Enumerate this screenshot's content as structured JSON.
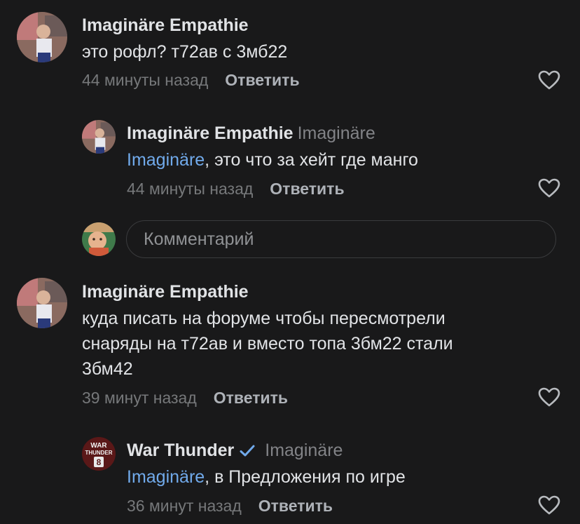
{
  "comments": [
    {
      "author": "Imaginäre Empathie",
      "text": "это рофл? т72ав с 3мб22",
      "time": "44 минуты назад",
      "reply_label": "Ответить"
    },
    {
      "author": "Imaginäre Empathie",
      "reply_to": "Imaginäre",
      "mention": "Imaginäre",
      "text": ", это что за хейт где манго",
      "time": "44 минуты назад",
      "reply_label": "Ответить"
    },
    {
      "author": "Imaginäre Empathie",
      "text": "куда писать на форуме чтобы пересмотрели\nснаряды на т72ав и вместо топа 3бм22 стали\n3бм42",
      "time": "39 минут назад",
      "reply_label": "Ответить"
    },
    {
      "author": "War Thunder",
      "reply_to": "Imaginäre",
      "mention": "Imaginäre",
      "text": ", в Предложения по игре",
      "time": "36 минут назад",
      "reply_label": "Ответить"
    }
  ],
  "comment_input": {
    "placeholder": "Комментарий"
  },
  "avatar_logo_text": {
    "line1": "WAR",
    "line2": "THUNDER",
    "line3": "8"
  },
  "colors": {
    "background": "#19191a",
    "mention": "#71aaeb",
    "verified": "#71aaeb"
  }
}
